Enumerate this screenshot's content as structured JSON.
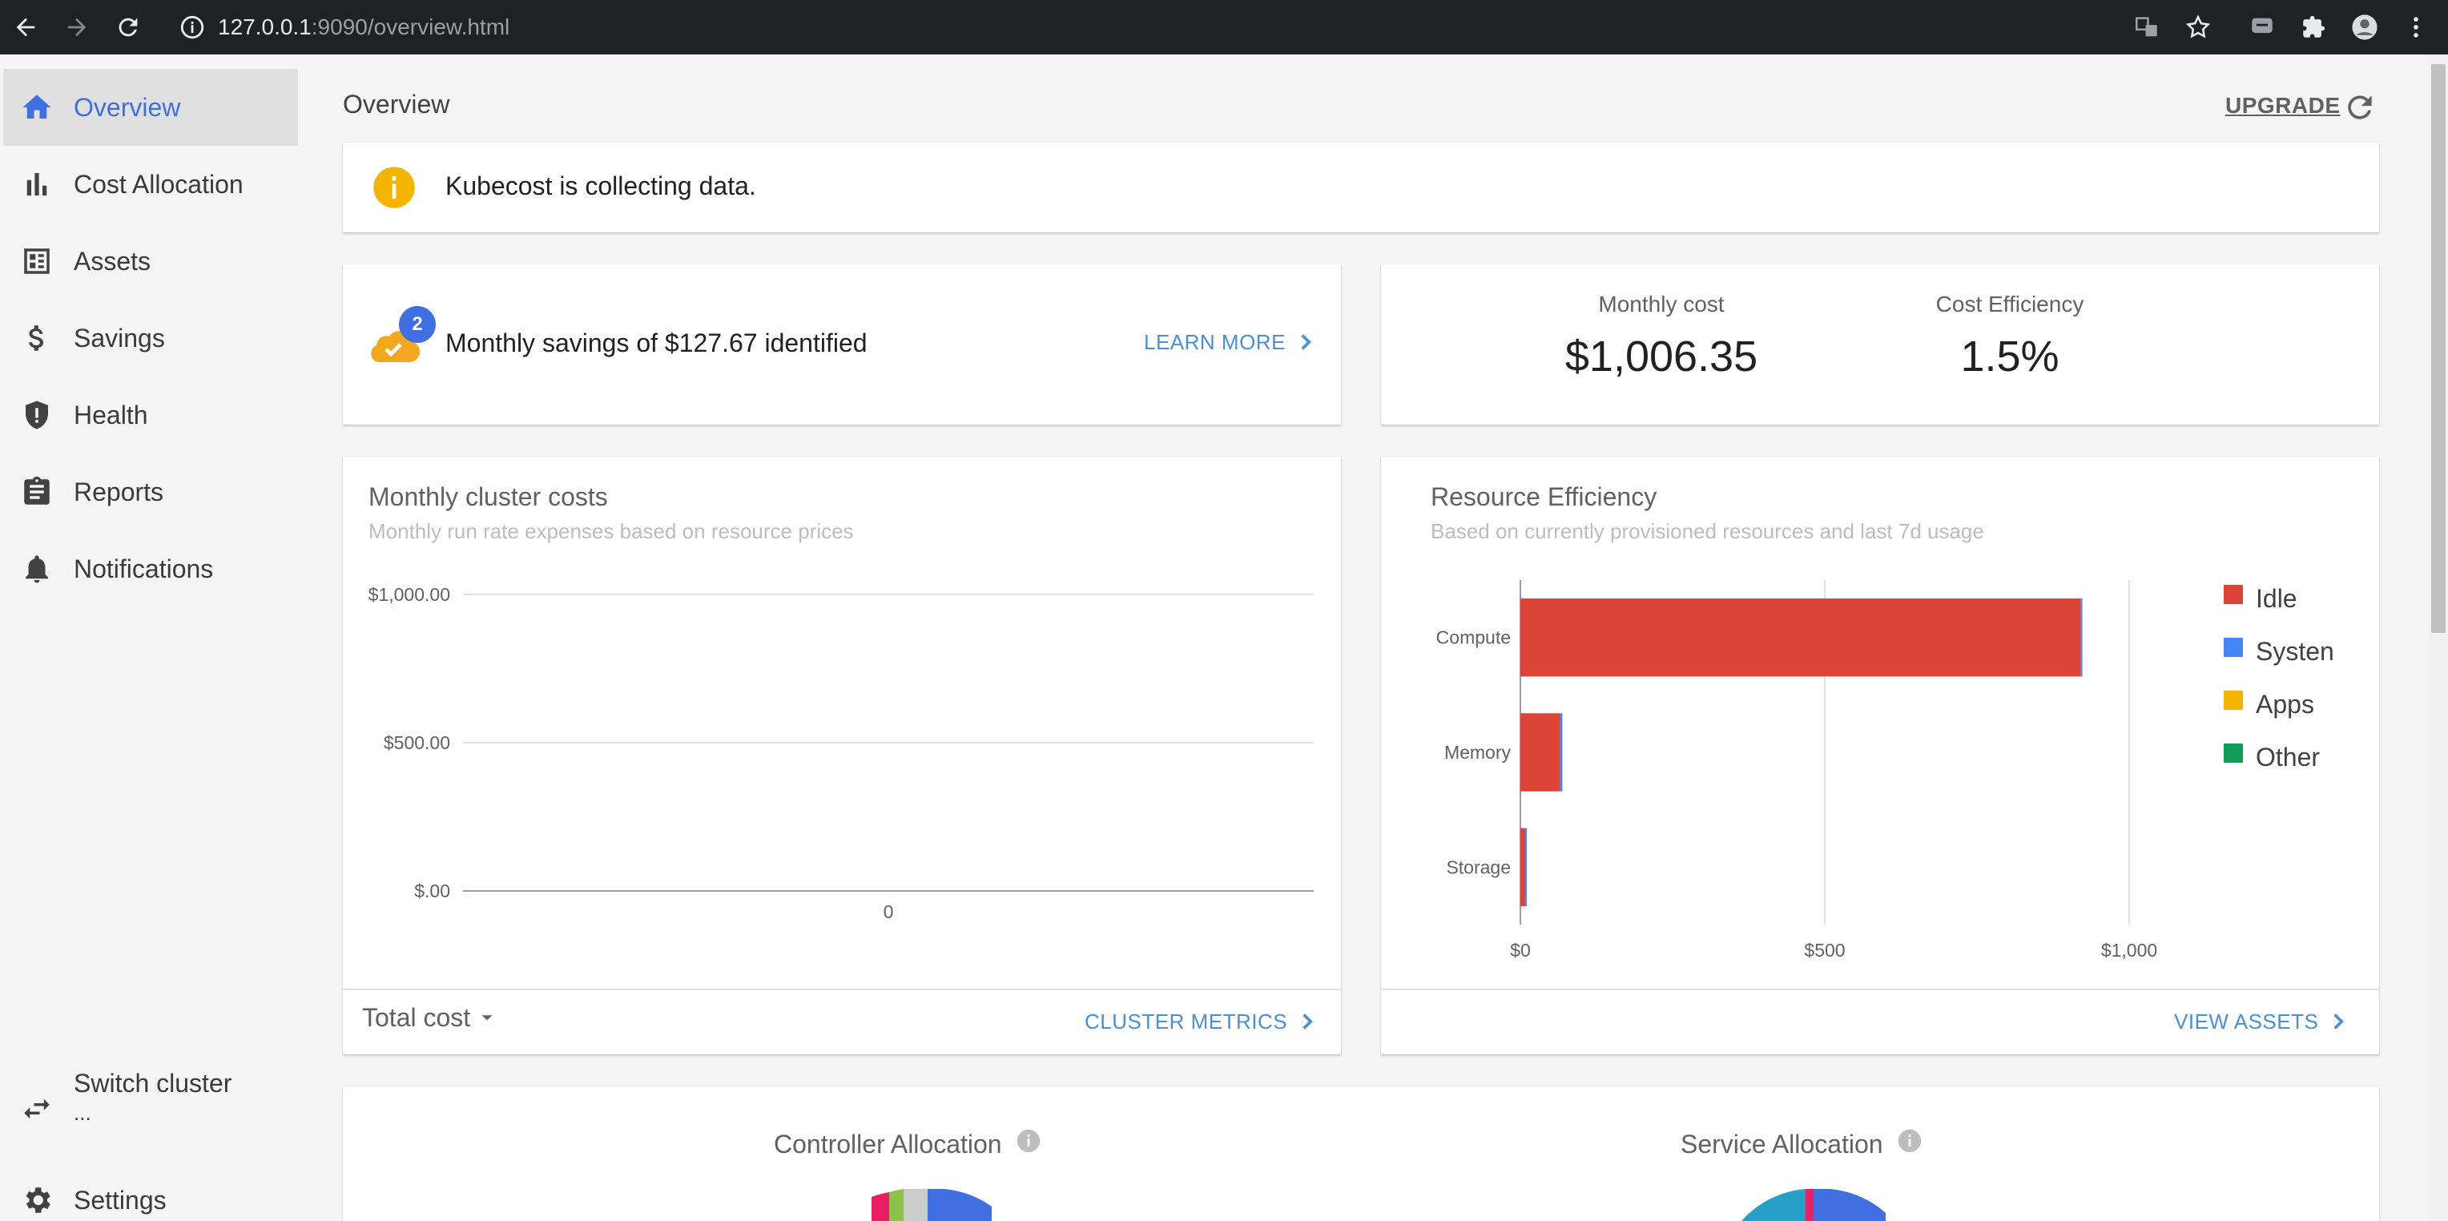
{
  "browser": {
    "url_host": "127.0.0.1",
    "url_rest": ":9090/overview.html"
  },
  "sidebar": {
    "items": [
      {
        "label": "Overview",
        "icon": "home-icon",
        "active": true
      },
      {
        "label": "Cost Allocation",
        "icon": "bar-chart-icon"
      },
      {
        "label": "Assets",
        "icon": "assets-icon"
      },
      {
        "label": "Savings",
        "icon": "dollar-icon"
      },
      {
        "label": "Health",
        "icon": "alert-shield-icon"
      },
      {
        "label": "Reports",
        "icon": "clipboard-icon"
      },
      {
        "label": "Notifications",
        "icon": "bell-icon"
      }
    ],
    "switch_cluster": "Switch cluster",
    "switch_cluster_sub": "...",
    "settings": "Settings"
  },
  "header": {
    "title": "Overview",
    "upgrade": "UPGRADE"
  },
  "banner": {
    "text": "Kubecost is collecting data."
  },
  "savings": {
    "badge": "2",
    "text": "Monthly savings of $127.67 identified",
    "link": "LEARN MORE"
  },
  "summary": {
    "monthly_cost_label": "Monthly cost",
    "monthly_cost_value": "$1,006.35",
    "efficiency_label": "Cost Efficiency",
    "efficiency_value": "1.5%"
  },
  "cluster_costs": {
    "title": "Monthly cluster costs",
    "subtitle": "Monthly run rate expenses based on resource prices",
    "dropdown": "Total cost",
    "link": "CLUSTER METRICS"
  },
  "resource_efficiency": {
    "title": "Resource Efficiency",
    "subtitle": "Based on currently provisioned resources and last 7d usage",
    "link": "VIEW ASSETS"
  },
  "allocation": {
    "controller": "Controller Allocation",
    "service": "Service Allocation"
  },
  "colors": {
    "accent": "#3f6fe0",
    "idle": "#db4437",
    "system": "#4285f4",
    "apps": "#f4b400",
    "other": "#0f9d58"
  },
  "chart_data": [
    {
      "type": "line",
      "title": "Monthly cluster costs",
      "x": [
        "0"
      ],
      "yticks": [
        "$1,000.00",
        "$500.00",
        "$.00"
      ],
      "ylim": [
        0,
        1000
      ],
      "series": []
    },
    {
      "type": "bar",
      "orientation": "horizontal",
      "stacked": true,
      "title": "Resource Efficiency",
      "categories": [
        "Compute",
        "Memory",
        "Storage"
      ],
      "xticks": [
        "$0",
        "$500",
        "$1,000"
      ],
      "xlim": [
        0,
        1000
      ],
      "series": [
        {
          "name": "Idle",
          "color": "#db4437",
          "values": [
            920,
            65,
            8
          ]
        },
        {
          "name": "Systen",
          "color": "#4285f4",
          "values": [
            3,
            4,
            2
          ]
        },
        {
          "name": "Apps",
          "color": "#f4b400",
          "values": [
            0,
            0,
            0
          ]
        },
        {
          "name": "Other",
          "color": "#0f9d58",
          "values": [
            0,
            0,
            0
          ]
        }
      ],
      "legend": "right"
    }
  ]
}
